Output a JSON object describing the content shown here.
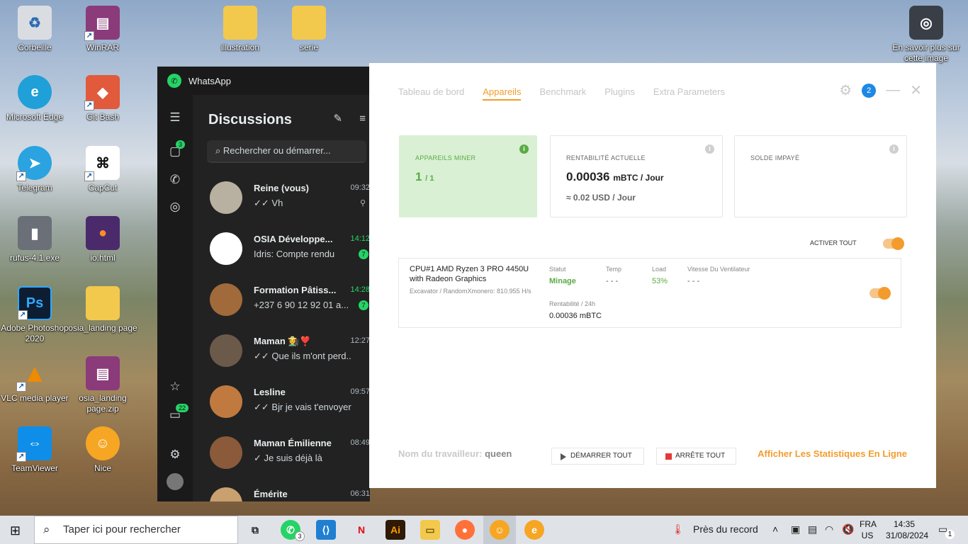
{
  "desktop": {
    "icons": [
      {
        "label": "Corbeille"
      },
      {
        "label": "WinRAR"
      },
      {
        "label": "illustration"
      },
      {
        "label": "serie"
      },
      {
        "label": "En savoir plus sur cette image"
      },
      {
        "label": "Microsoft Edge"
      },
      {
        "label": "Git Bash"
      },
      {
        "label": "Telegram"
      },
      {
        "label": "CapCut"
      },
      {
        "label": "rufus-4.1.exe"
      },
      {
        "label": "io.html"
      },
      {
        "label": "Adobe Photoshop 2020"
      },
      {
        "label": "osia_landing page"
      },
      {
        "label": "VLC media player"
      },
      {
        "label": "osia_landing page.zip"
      },
      {
        "label": "TeamViewer"
      },
      {
        "label": "Nice"
      }
    ]
  },
  "whatsapp": {
    "title": "WhatsApp",
    "panel_title": "Discussions",
    "search_placeholder": "Rechercher ou démarrer...",
    "chats_badge": "3",
    "archive_badge": "22",
    "chats": [
      {
        "name": "Reine (vous)",
        "time": "09:32",
        "message": "✓✓ Vh",
        "unread": ""
      },
      {
        "name": "OSIA Développe...",
        "time": "14:12",
        "message": "Idris: Compte rendu",
        "unread": "7"
      },
      {
        "name": "Formation Pâtiss...",
        "time": "14:28",
        "message": "+237 6 90 12 92 01 a...",
        "unread": "7"
      },
      {
        "name": "Maman 👩‍🌾❣️",
        "time": "12:27",
        "message": "✓✓ Que ils m'ont perd...",
        "unread": ""
      },
      {
        "name": "Lesline",
        "time": "09:57",
        "message": "✓✓ Bjr je vais t'envoyer...",
        "unread": ""
      },
      {
        "name": "Maman Émilienne",
        "time": "08:49",
        "message": "✓ Je suis déjà là",
        "unread": ""
      },
      {
        "name": "Émérite",
        "time": "06:31",
        "message": "",
        "unread": ""
      }
    ]
  },
  "miner": {
    "tabs": [
      "Tableau de bord",
      "Appareils",
      "Benchmark",
      "Plugins",
      "Extra Parameters"
    ],
    "active_tab": "Appareils",
    "notification_count": "2",
    "cards": {
      "devices": {
        "title": "APPAREILS MINER",
        "value": "1",
        "total": "/ 1"
      },
      "profit": {
        "title": "RENTABILITÉ ACTUELLE",
        "value": "0.00036",
        "unit": "mBTC / Jour",
        "usd": "≈ 0.02 USD / Jour"
      },
      "balance": {
        "title": "SOLDE IMPAYÉ"
      }
    },
    "enable_all_label": "ACTIVER TOUT",
    "device": {
      "name": "CPU#1 AMD Ryzen 3 PRO 4450U with Radeon Graphics",
      "algo": "Excavator / RandomXmonero: 810.955 H/s",
      "status_label": "Statut",
      "status_value": "Minage",
      "temp_label": "Temp",
      "temp_value": "- - -",
      "load_label": "Load",
      "load_value": "53%",
      "fan_label": "Vitesse Du Ventilateur",
      "fan_value": "- - -",
      "profit_label": "Rentabilité / 24h",
      "profit_value": "0.00036 mBTC"
    },
    "worker_label": "Nom du travailleur:",
    "worker_name": "queen",
    "start_all": "DÉMARRER TOUT",
    "stop_all": "ARRÊTE TOUT",
    "online_stats": "Afficher Les Statistiques En Ligne"
  },
  "taskbar": {
    "search_placeholder": "Taper ici pour rechercher",
    "whatsapp_badge": "3",
    "weather": "Près du record",
    "lang_top": "FRA",
    "lang_bottom": "US",
    "time": "14:35",
    "date": "31/08/2024",
    "notifications": "1"
  }
}
